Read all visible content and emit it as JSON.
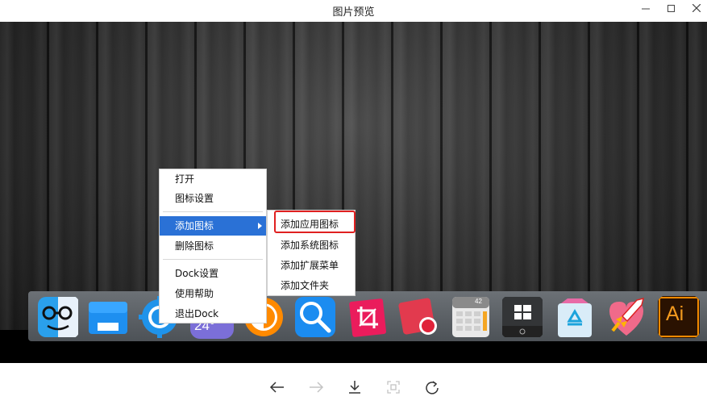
{
  "window": {
    "title": "图片预览"
  },
  "context_menu": {
    "items": [
      {
        "label": "打开"
      },
      {
        "label": "图标设置"
      },
      {
        "label": "添加图标"
      },
      {
        "label": "删除图标"
      },
      {
        "label": "Dock设置"
      },
      {
        "label": "使用帮助"
      },
      {
        "label": "退出Dock"
      }
    ],
    "active_item": "添加图标"
  },
  "submenu": {
    "items": [
      {
        "label": "添加应用图标"
      },
      {
        "label": "添加系统图标"
      },
      {
        "label": "添加扩展菜单"
      },
      {
        "label": "添加文件夹"
      }
    ],
    "highlighted_item": "添加应用图标",
    "highlight_color": "#e02020"
  },
  "dock": {
    "icons": [
      {
        "name": "finder-icon"
      },
      {
        "name": "folder-icon"
      },
      {
        "name": "settings-gear-icon"
      },
      {
        "name": "weather-icon",
        "text": "24°"
      },
      {
        "name": "half-circle-icon"
      },
      {
        "name": "search-magnifier-icon"
      },
      {
        "name": "crop-icon"
      },
      {
        "name": "record-icon"
      },
      {
        "name": "calculator-icon",
        "text": "42"
      },
      {
        "name": "windows-icon"
      },
      {
        "name": "recycle-bin-icon"
      },
      {
        "name": "rocket-icon"
      },
      {
        "name": "illustrator-icon",
        "text": "Ai"
      }
    ]
  },
  "toolbar": {
    "buttons": [
      {
        "name": "back-arrow-icon",
        "enabled": true
      },
      {
        "name": "forward-arrow-icon",
        "enabled": false
      },
      {
        "name": "download-icon",
        "enabled": true
      },
      {
        "name": "fit-screen-icon",
        "enabled": false
      },
      {
        "name": "rotate-icon",
        "enabled": true
      }
    ]
  },
  "colors": {
    "menu_active": "#2a71d6",
    "menu_bg": "#ffffff"
  }
}
